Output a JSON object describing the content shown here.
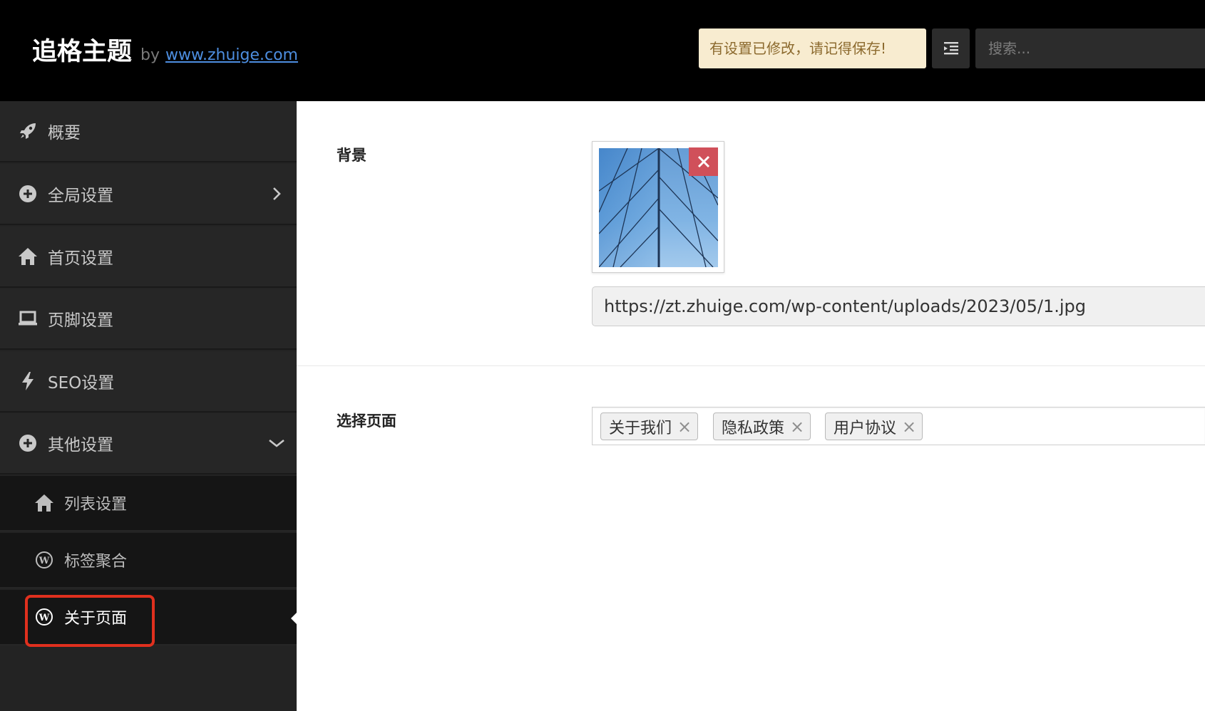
{
  "header": {
    "title": "追格主题",
    "by_text": "by",
    "link_text": "www.zhuige.com",
    "notice": "有设置已修改，请记得保存!",
    "expand_icon": "indent-icon",
    "search_placeholder": "搜索..."
  },
  "sidebar": {
    "items": [
      {
        "label": "概要",
        "icon": "rocket-icon"
      },
      {
        "label": "全局设置",
        "icon": "plus-circle-icon",
        "chevron": "chevron-right"
      },
      {
        "label": "首页设置",
        "icon": "home-icon"
      },
      {
        "label": "页脚设置",
        "icon": "laptop-icon"
      },
      {
        "label": "SEO设置",
        "icon": "bolt-icon"
      },
      {
        "label": "其他设置",
        "icon": "plus-circle-icon",
        "chevron": "chevron-down",
        "expanded": true
      }
    ],
    "sub_items": [
      {
        "label": "列表设置",
        "icon": "home-icon"
      },
      {
        "label": "标签聚合",
        "icon": "wordpress-icon"
      },
      {
        "label": "关于页面",
        "icon": "wordpress-icon",
        "active": true
      }
    ]
  },
  "fields": {
    "background": {
      "label": "背景",
      "url": "https://zt.zhuige.com/wp-content/uploads/2023/05/1.jpg"
    },
    "pages": {
      "label": "选择页面",
      "tags": [
        "关于我们",
        "隐私政策",
        "用户协议"
      ]
    }
  },
  "colors": {
    "header_bg": "#000000",
    "sidebar_bg": "#262626",
    "submenu_bg": "#151515",
    "notice_bg": "#f8ecd0",
    "remove_button": "#d0505a",
    "active_highlight": "#e0301e",
    "link": "#4d8ee0"
  }
}
